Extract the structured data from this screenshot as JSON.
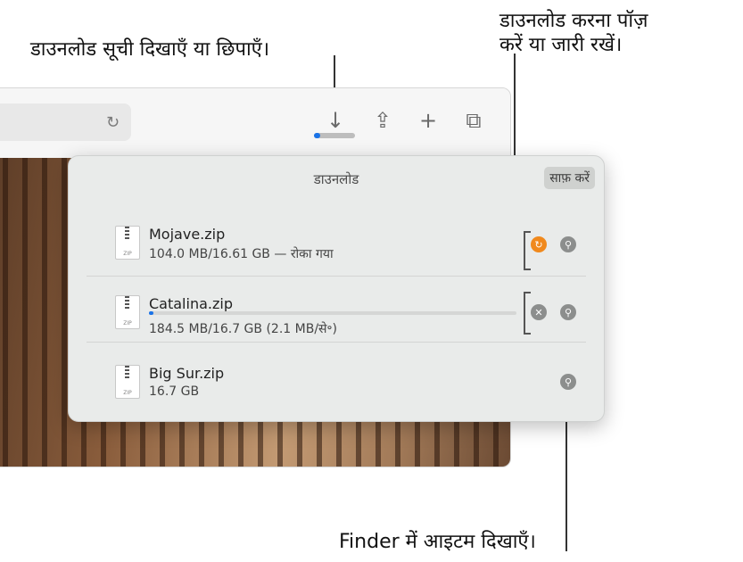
{
  "callouts": {
    "toggle_list": "डाउनलोड सूची दिखाएँ या छिपाएँ।",
    "pause_resume_line1": "डाउनलोड करना पॉज़",
    "pause_resume_line2": "करें या जारी रखें।",
    "show_in_finder": "Finder में आइटम दिखाएँ।"
  },
  "toolbar": {
    "reload_icon": "↻",
    "download_icon": "↓",
    "share_icon": "⇪",
    "new_tab_icon": "+",
    "tabs_icon": "⧉",
    "progress_fraction": 0.15
  },
  "popover": {
    "title": "डाउनलोड",
    "clear_label": "साफ़ करें",
    "items": [
      {
        "name": "Mojave.zip",
        "meta": "104.0 MB/16.61 GB — रोका गया",
        "ext": "ZIP"
      },
      {
        "name": "Catalina.zip",
        "meta": "184.5 MB/16.7 GB (2.1 MB/से॰)",
        "ext": "ZIP",
        "progress_fraction": 0.011
      },
      {
        "name": "Big Sur.zip",
        "meta": "16.7 GB",
        "ext": "ZIP"
      }
    ]
  },
  "colors": {
    "accent": "#1a73e8",
    "resume": "#f0891d"
  }
}
